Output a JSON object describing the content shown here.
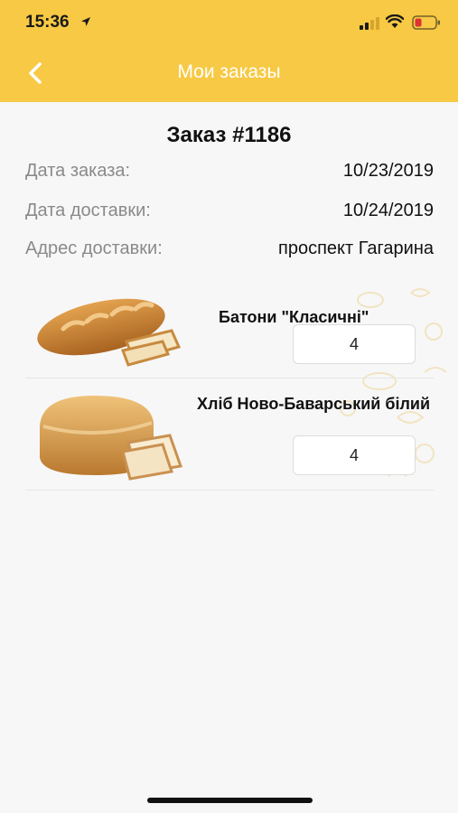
{
  "status_bar": {
    "time": "15:36"
  },
  "nav": {
    "title": "Мои заказы",
    "back_icon": "chevron-left-icon"
  },
  "order": {
    "title": "Заказ #1186",
    "fields": [
      {
        "label": "Дата заказа:",
        "value": "10/23/2019"
      },
      {
        "label": "Дата доставки:",
        "value": "10/24/2019"
      },
      {
        "label": "Адрес доставки:",
        "value": "проспект Гагарина"
      }
    ]
  },
  "products": [
    {
      "name": "Батони \"Класичні\"",
      "quantity": "4",
      "image": "baton-bread-image"
    },
    {
      "name": "Хліб Ново-Баварський білий",
      "quantity": "4",
      "image": "white-bread-loaf-image"
    }
  ],
  "colors": {
    "header": "#f7c944",
    "background": "#f7f7f7",
    "accent": "#f7c944"
  }
}
